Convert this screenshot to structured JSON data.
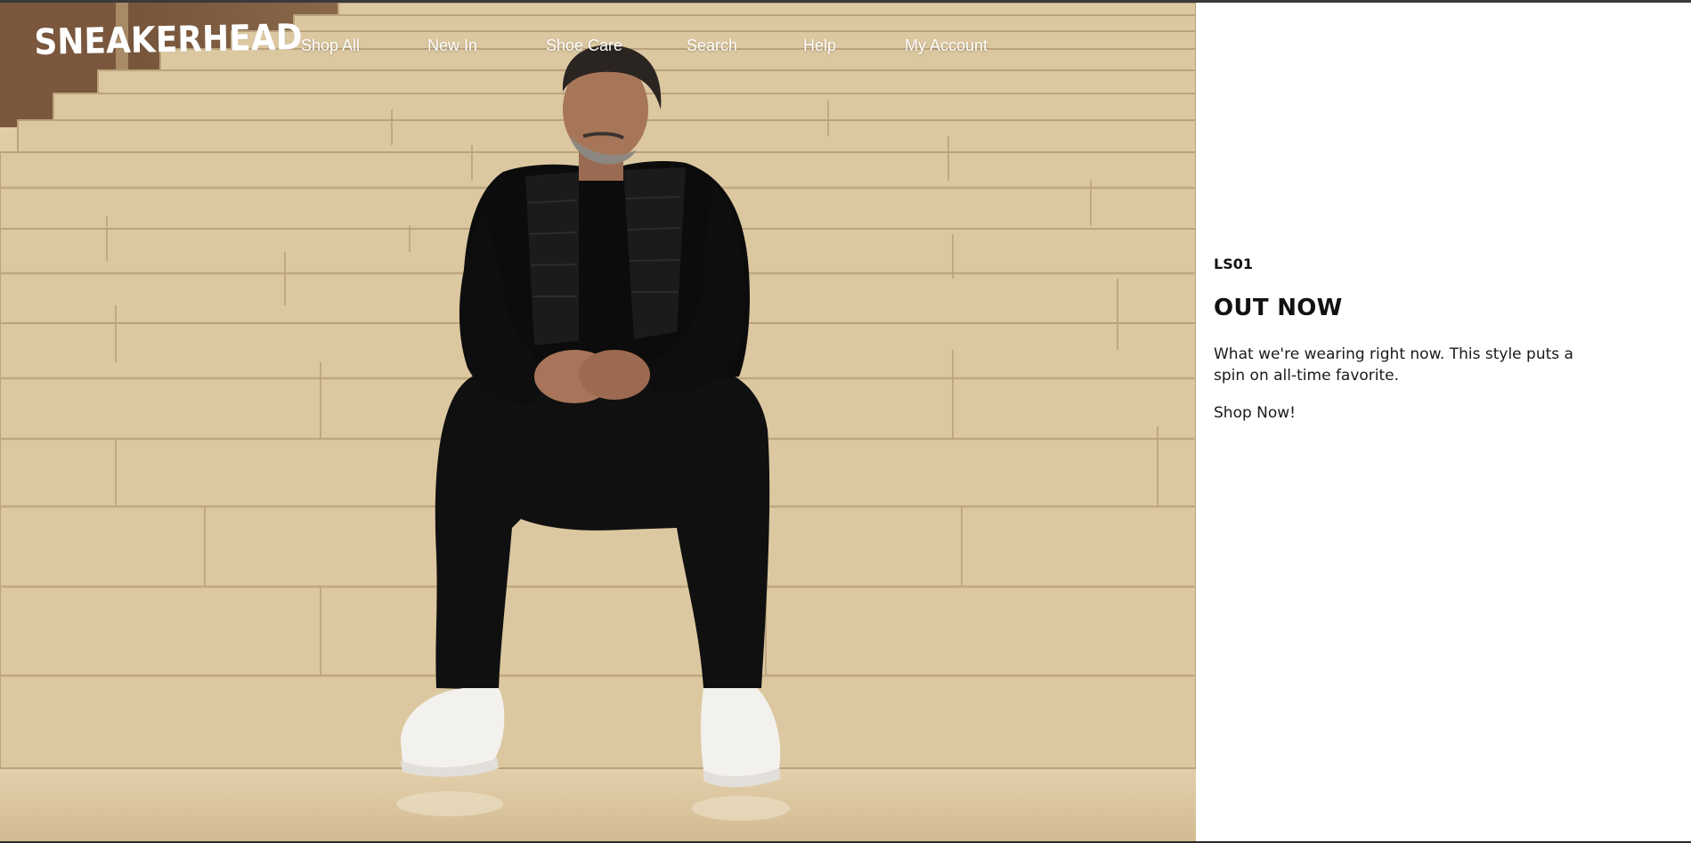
{
  "brand": {
    "logo_text": "SNEAKERHEAD"
  },
  "nav": {
    "items": [
      {
        "label": "Shop All"
      },
      {
        "label": "New In"
      },
      {
        "label": "Shoe Care"
      },
      {
        "label": "Search"
      },
      {
        "label": "Help"
      },
      {
        "label": "My Account"
      }
    ]
  },
  "hero": {
    "image_subject": "man-sitting-on-stone-steps"
  },
  "promo": {
    "eyebrow": "LS01",
    "headline": "OUT NOW",
    "description": "What we're wearing right now. This style puts a spin on all-time favorite.",
    "cta_label": "Shop Now!"
  },
  "colors": {
    "nav_text": "#ffffff",
    "panel_bg": "#ffffff",
    "body_text": "#111111",
    "stone": "#d8c39c"
  }
}
